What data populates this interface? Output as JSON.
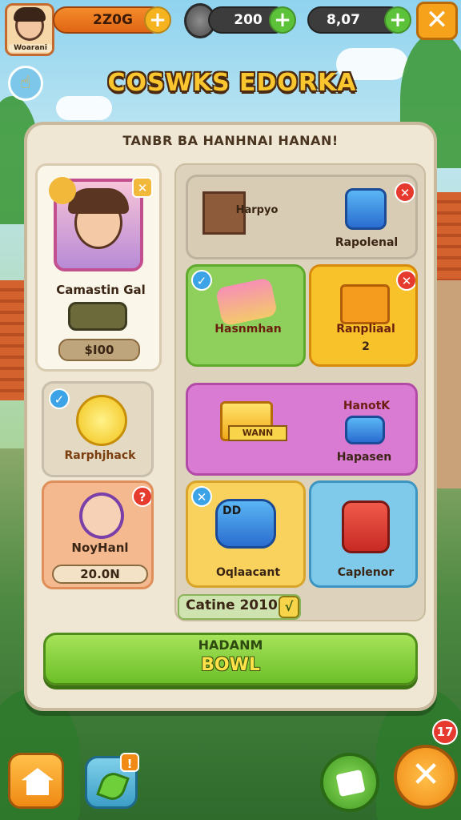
{
  "colors": {
    "accent_orange": "#f7a21b",
    "accent_green": "#6cbf28",
    "badge_red": "#e63a2e",
    "badge_blue": "#3ca4e6",
    "panel_bg": "#efe6d4",
    "title_yellow": "#f9c62f"
  },
  "topbar": {
    "profile_name": "Woarani",
    "currency_1": {
      "value": "2Z0G",
      "icon": "coin-icon"
    },
    "currency_2": {
      "value": "200",
      "icon": "pickaxe-icon"
    },
    "currency_3": {
      "value": "8,07",
      "icon": "gem-icon"
    },
    "plus": "+",
    "close": "✕"
  },
  "title": "COSWKS EDORKA",
  "panel": {
    "subtitle": "TANBR BA HANHNAI HANAN!",
    "featured": {
      "name": "Camastin Gal",
      "price": "$I00",
      "close": "✕"
    },
    "left_items": [
      {
        "name": "Rarphjhack",
        "badge": "✓"
      },
      {
        "name": "NoyHanl",
        "price": "20.0N",
        "badge": "?"
      }
    ],
    "grid": [
      {
        "name": "Rapolenal",
        "top_label": "Harpyo",
        "badge": "✕"
      },
      {
        "name": "Hasnmhan",
        "badge": "✓"
      },
      {
        "name": "Ranpliaal",
        "sub": "2",
        "badge": "✕"
      },
      {
        "name": "Hapasen",
        "top_label": "HanotK",
        "banner": "WANN"
      },
      {
        "name": "Oqlaacant",
        "badge": "✕",
        "mark": "DD"
      },
      {
        "name": "Caplenor"
      }
    ],
    "footer": {
      "label": "Catine 2010",
      "check": "√"
    },
    "action_button": {
      "line1": "HADANM",
      "line2": "BOWL"
    }
  },
  "bottom": {
    "home": "home-icon",
    "shop_badge": "!",
    "notif_count": "17"
  }
}
